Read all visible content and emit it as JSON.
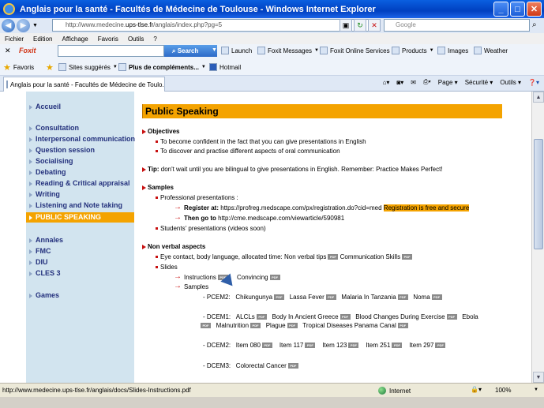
{
  "window": {
    "title": "Anglais pour la santé - Facultés de Médecine de Toulouse - Windows Internet Explorer",
    "min": "_",
    "max": "□",
    "close": "✕"
  },
  "address": {
    "pre": "http://www.medecine.",
    "domain": "ups-tlse.fr",
    "post": "/anglais/index.php?pg=5",
    "search_placeholder": "Google"
  },
  "menu": [
    "Fichier",
    "Edition",
    "Affichage",
    "Favoris",
    "Outils",
    "?"
  ],
  "foxbar": {
    "brand": "Foxit",
    "search": "Search",
    "items": [
      "Launch",
      "Foxit Messages",
      "Foxit Online Services",
      "Products",
      "Images",
      "Weather"
    ]
  },
  "favbar": {
    "favorites": "Favoris",
    "items": [
      "Sites suggérés",
      "Plus de compléments...",
      "Hotmail"
    ]
  },
  "tab": {
    "title": "Anglais pour la santé - Facultés de Médecine de Toulo..."
  },
  "tools": {
    "page": "Page",
    "security": "Sécurité",
    "tools": "Outils"
  },
  "sidebar": {
    "items": [
      {
        "label": "Accueil"
      },
      {
        "label": "Consultation"
      },
      {
        "label": "Interpersonal communication"
      },
      {
        "label": "Question session"
      },
      {
        "label": "Socialising"
      },
      {
        "label": "Debating"
      },
      {
        "label": "Reading & Critical appraisal"
      },
      {
        "label": "Writing"
      },
      {
        "label": "Listening and Note taking"
      },
      {
        "label": "PUBLIC SPEAKING"
      },
      {
        "label": "Annales"
      },
      {
        "label": "FMC"
      },
      {
        "label": "DIU"
      },
      {
        "label": "CLES 3"
      },
      {
        "label": "Games"
      }
    ]
  },
  "content": {
    "heading": "Public Speaking",
    "objectives": {
      "title": "Objectives",
      "items": [
        "To become confident in the fact that you can give presentations in English",
        "To discover and practise different aspects of oral communication"
      ]
    },
    "tip": {
      "label": "Tip:",
      "text": " don't wait until you are bilingual to give presentations in English. Remember: Practice Makes Perfect!"
    },
    "samples": {
      "title": "Samples",
      "professional": "Professional presentations :",
      "register_label": "Register at:",
      "register_url": " https://profreg.medscape.com/px/registration.do?cid=med ",
      "register_note": "Registration is free and secure",
      "goto_label": "Then go to",
      "goto_url": " http://cme.medscape.com/viewarticle/590981",
      "students": "Students' presentations (videos soon)"
    },
    "nonverbal": {
      "title": "Non verbal aspects",
      "eye": "Eye contact, body language, allocated time: Non verbal tips",
      "comm": "Communication Skills",
      "slides": "Slides",
      "instructions": "Instructions",
      "convincing": "Convincing",
      "samples": "Samples"
    },
    "pdf": "PDF",
    "pcem2": {
      "label": "- PCEM2:",
      "items": [
        "Chikungunya",
        "Lassa Fever",
        "Malaria In Tanzania",
        "Noma"
      ]
    },
    "dcem1": {
      "label": "- DCEM1:",
      "line1": [
        "ALCLs",
        "Body In Ancient Greece",
        "Blood Changes During Exercise",
        "Ebola"
      ],
      "line2": [
        "Malnutrition",
        "Plague",
        "Tropical Diseases Panama Canal"
      ]
    },
    "dcem2": {
      "label": "- DCEM2:",
      "items": [
        "Item 080",
        "Item 117",
        "Item 123",
        "Item 251",
        "Item 297"
      ]
    },
    "dcem3": {
      "label": "- DCEM3:",
      "items": [
        "Colorectal Cancer"
      ]
    }
  },
  "status": {
    "url": "http://www.medecine.ups-tlse.fr/anglais/docs/Slides-Instructions.pdf",
    "zone": "Internet",
    "zoom": "100%"
  }
}
